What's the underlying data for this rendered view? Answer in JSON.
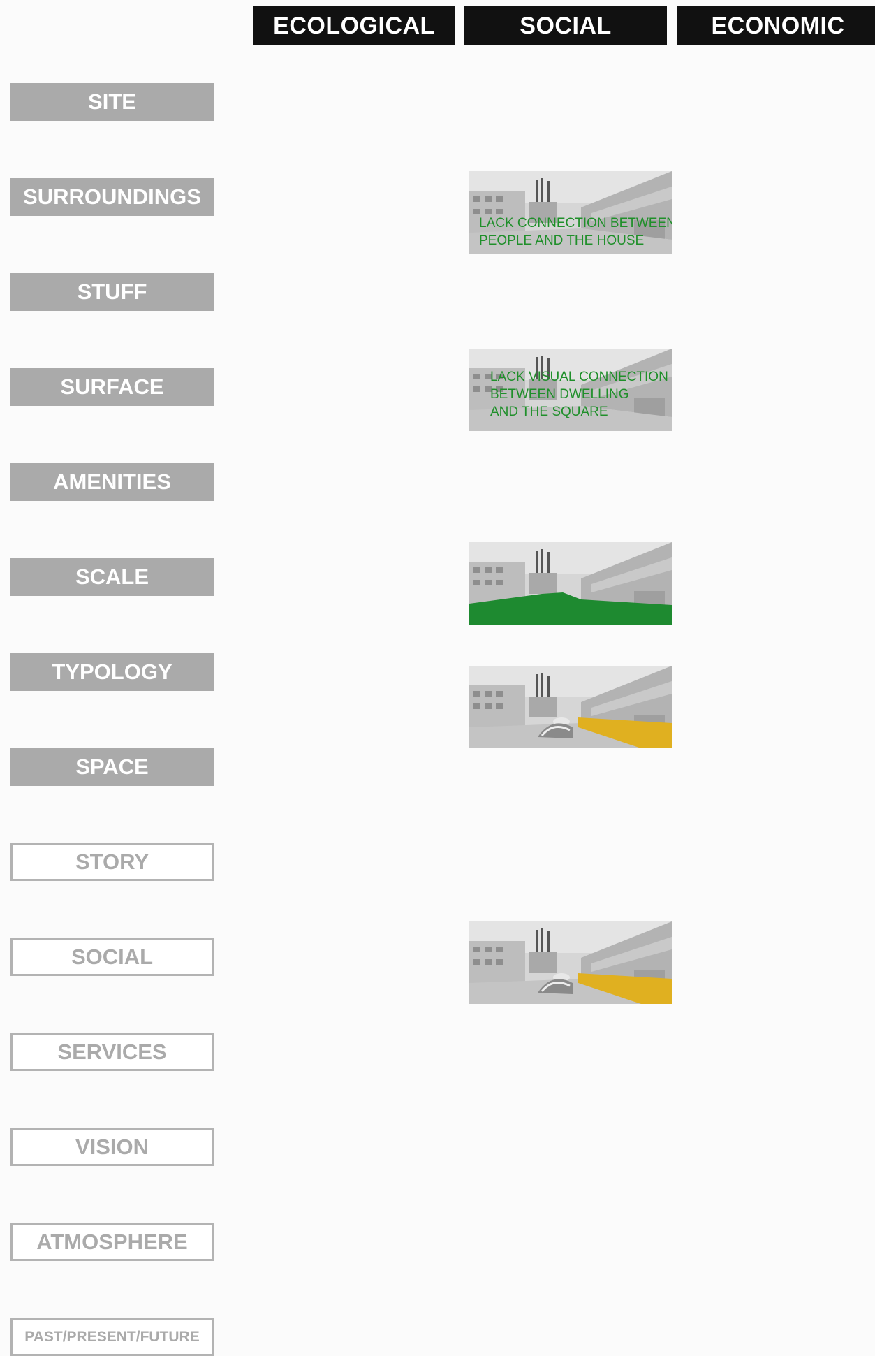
{
  "columns": [
    "ECOLOGICAL",
    "SOCIAL",
    "ECONOMIC"
  ],
  "rows": [
    "SITE",
    "SURROUNDINGS",
    "STUFF",
    "SURFACE",
    "AMENITIES",
    "SCALE",
    "TYPOLOGY",
    "SPACE",
    "STORY",
    "SOCIAL",
    "SERVICES",
    "VISION",
    "ATMOSPHERE",
    "PAST/PRESENT/FUTURE"
  ],
  "captions": {
    "surroundings": [
      "LACK CONNECTION BETWEEN",
      "PEOPLE AND THE HOUSE"
    ],
    "surface": [
      "LACK VISUAL CONNECTION",
      "BETWEEN DWELLING",
      "AND THE SQUARE"
    ]
  },
  "colors": {
    "header_bg": "#111111",
    "filled_label_bg": "#aaaaaa",
    "outline_label": "#b3b3b3",
    "caption_text": "#1f8f2a",
    "highlight_green": "#1e8a30",
    "highlight_yellow": "#e0b020"
  }
}
